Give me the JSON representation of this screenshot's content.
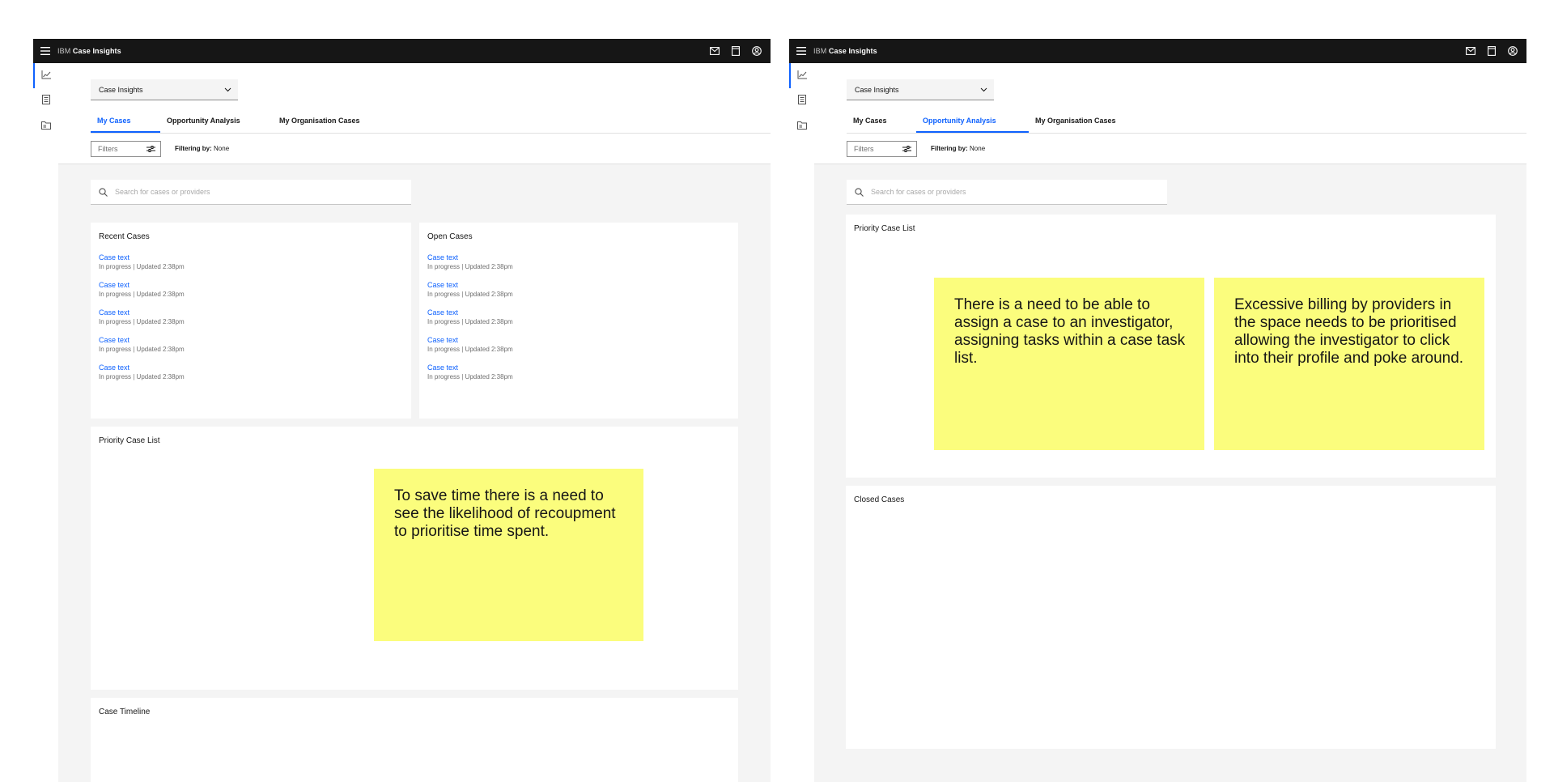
{
  "header": {
    "brand_prefix": "IBM",
    "brand_name": "Case Insights"
  },
  "icons": {
    "menu": "hamburger-menu-icon",
    "mail": "mail-icon",
    "notes": "notebook-icon",
    "user": "user-avatar-icon",
    "rail": [
      "analytics-chart-icon",
      "document-list-icon",
      "folder-icon"
    ]
  },
  "dropdown": {
    "value": "Case Insights"
  },
  "tabs": [
    {
      "label": "My Cases"
    },
    {
      "label": "Opportunity Analysis"
    },
    {
      "label": "My Organisation Cases"
    }
  ],
  "filters": {
    "label": "Filters",
    "filtering_label": "Filtering by:",
    "filtering_value": "None"
  },
  "search": {
    "placeholder": "Search for cases or providers"
  },
  "colors": {
    "accent": "#0f62fe",
    "topbar": "#161616",
    "sticky_note": "#fbfd7d",
    "background": "#f4f4f4"
  },
  "frame1": {
    "active_tab": "My Cases",
    "recent_cases": {
      "title": "Recent Cases",
      "items": [
        {
          "link": "Case text",
          "status": "In progress | Updated 2:38pm"
        },
        {
          "link": "Case text",
          "status": "In progress | Updated 2:38pm"
        },
        {
          "link": "Case text",
          "status": "In progress | Updated 2:38pm"
        },
        {
          "link": "Case text",
          "status": "In progress | Updated 2:38pm"
        },
        {
          "link": "Case text",
          "status": "In progress | Updated 2:38pm"
        }
      ]
    },
    "open_cases": {
      "title": "Open Cases",
      "items": [
        {
          "link": "Case text",
          "status": "In progress | Updated 2:38pm"
        },
        {
          "link": "Case text",
          "status": "In progress | Updated 2:38pm"
        },
        {
          "link": "Case text",
          "status": "In progress | Updated 2:38pm"
        },
        {
          "link": "Case text",
          "status": "In progress | Updated 2:38pm"
        },
        {
          "link": "Case text",
          "status": "In progress | Updated 2:38pm"
        }
      ]
    },
    "priority_case_list": {
      "title": "Priority Case List"
    },
    "case_timeline": {
      "title": "Case Timeline"
    },
    "sticky_note": "To save time there is a need to see the likelihood of recoupment to prioritise time spent."
  },
  "frame2": {
    "active_tab": "Opportunity Analysis",
    "priority_case_list": {
      "title": "Priority Case List"
    },
    "closed_cases": {
      "title": "Closed Cases"
    },
    "sticky_note_1": "There is a need to be able to assign a case to an investigator, assigning tasks within a case task list.",
    "sticky_note_2": "Excessive billing by providers in the space needs to be prioritised allowing the investigator to click into their profile and poke around."
  }
}
